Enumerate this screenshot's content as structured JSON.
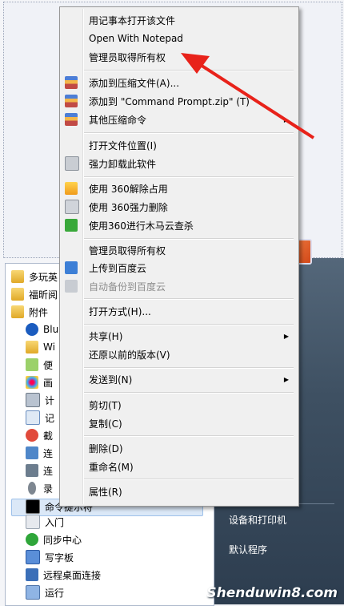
{
  "context_menu": {
    "items": [
      {
        "label": "用记事本打开该文件",
        "icon": ""
      },
      {
        "label": "Open With Notepad",
        "icon": ""
      },
      {
        "label": "管理员取得所有权",
        "icon": ""
      },
      {
        "label": "添加到压缩文件(A)...",
        "icon": "winrar-icon"
      },
      {
        "label": "添加到 \"Command Prompt.zip\" (T)",
        "icon": "winrar-icon"
      },
      {
        "label": "其他压缩命令",
        "icon": "winrar-icon",
        "submenu": true
      },
      {
        "label": "打开文件位置(I)",
        "icon": ""
      },
      {
        "label": "强力卸载此软件",
        "icon": "trash-icon"
      },
      {
        "label": "使用 360解除占用",
        "icon": "360-unlock-icon"
      },
      {
        "label": "使用 360强力删除",
        "icon": "360-shred-icon"
      },
      {
        "label": "使用360进行木马云查杀",
        "icon": "360-scan-icon"
      },
      {
        "label": "管理员取得所有权",
        "icon": ""
      },
      {
        "label": "上传到百度云",
        "icon": "baidu-cloud-icon"
      },
      {
        "label": "自动备份到百度云",
        "icon": "baidu-backup-icon",
        "disabled": true
      },
      {
        "label": "打开方式(H)...",
        "icon": ""
      },
      {
        "label": "共享(H)",
        "icon": "",
        "submenu": true
      },
      {
        "label": "还原以前的版本(V)",
        "icon": ""
      },
      {
        "label": "发送到(N)",
        "icon": "",
        "submenu": true
      },
      {
        "label": "剪切(T)",
        "icon": ""
      },
      {
        "label": "复制(C)",
        "icon": ""
      },
      {
        "label": "删除(D)",
        "icon": ""
      },
      {
        "label": "重命名(M)",
        "icon": ""
      },
      {
        "label": "属性(R)",
        "icon": ""
      }
    ]
  },
  "programs": {
    "items": [
      {
        "label": "多玩英",
        "icon": "folder-icon"
      },
      {
        "label": "福昕阅",
        "icon": "folder-icon"
      },
      {
        "label": "附件",
        "icon": "folder-icon"
      },
      {
        "label": "Blu",
        "icon": "bluetooth-icon"
      },
      {
        "label": "Wi",
        "icon": "windows-explorer-icon"
      },
      {
        "label": "便",
        "icon": "sticky-notes-icon"
      },
      {
        "label": "画",
        "icon": "paint-icon"
      },
      {
        "label": "计",
        "icon": "calculator-icon"
      },
      {
        "label": "记",
        "icon": "notepad-icon"
      },
      {
        "label": "截",
        "icon": "snipping-tool-icon"
      },
      {
        "label": "连",
        "icon": "network-projector-icon"
      },
      {
        "label": "连",
        "icon": "remote-connect-icon"
      },
      {
        "label": "录",
        "icon": "sound-recorder-icon"
      },
      {
        "label": "命令提示符",
        "icon": "cmd-icon",
        "selected": true
      },
      {
        "label": "入门",
        "icon": "getting-started-icon"
      },
      {
        "label": "同步中心",
        "icon": "sync-center-icon"
      },
      {
        "label": "写字板",
        "icon": "wordpad-icon"
      },
      {
        "label": "远程桌面连接",
        "icon": "remote-desktop-icon"
      },
      {
        "label": "运行",
        "icon": "run-icon"
      }
    ]
  },
  "right_pane": {
    "items": [
      "设备和打印机",
      "默认程序"
    ]
  },
  "watermark": "Shenduwin8.com",
  "colors": {
    "menu_bg": "#f0f0f0",
    "selection": "#dbe8f7",
    "arrow": "#e8221a",
    "start_pane": "#3e5062"
  }
}
